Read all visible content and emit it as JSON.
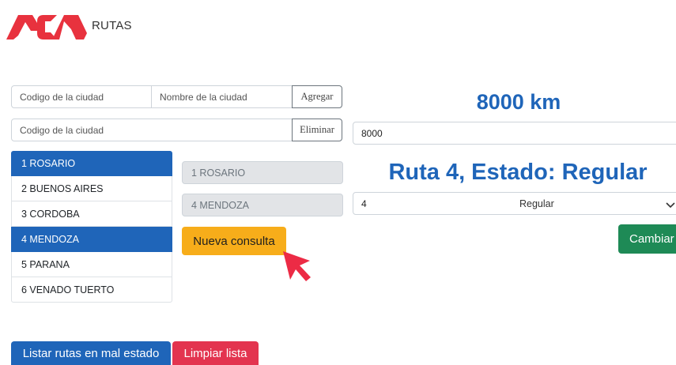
{
  "header": {
    "logo_text": "ACA",
    "title": "RUTAS",
    "brand_color": "#e8323e"
  },
  "add_form": {
    "code_placeholder": "Codigo de la ciudad",
    "name_placeholder": "Nombre de la ciudad",
    "add_label": "Agregar"
  },
  "remove_form": {
    "code_placeholder": "Codigo de la ciudad",
    "remove_label": "Eliminar"
  },
  "cities": [
    {
      "label": "1 ROSARIO",
      "selected": true
    },
    {
      "label": "2 BUENOS AIRES",
      "selected": false
    },
    {
      "label": "3 CORDOBA",
      "selected": false
    },
    {
      "label": "4 MENDOZA",
      "selected": true
    },
    {
      "label": "5 PARANA",
      "selected": false
    },
    {
      "label": "6 VENADO TUERTO",
      "selected": false
    }
  ],
  "query": {
    "origin": "1 ROSARIO",
    "destination": "4 MENDOZA",
    "new_query_label": "Nueva consulta"
  },
  "distance": {
    "heading": "8000 km",
    "value": "8000"
  },
  "route": {
    "heading": "Ruta 4, Estado: Regular",
    "number": "4",
    "status_selected": "Regular",
    "change_label": "Cambiar"
  },
  "footer": {
    "list_bad_label": "Listar rutas en mal estado",
    "clear_label": "Limpiar lista"
  },
  "icons": {
    "logo": "aca-logo",
    "cursor": "mouse-pointer-icon",
    "select_arrow": "chevron-down-icon"
  },
  "colors": {
    "primary": "#1f65b9",
    "warning": "#f7ad1a",
    "success": "#1e8a56",
    "danger": "#e3344f"
  }
}
